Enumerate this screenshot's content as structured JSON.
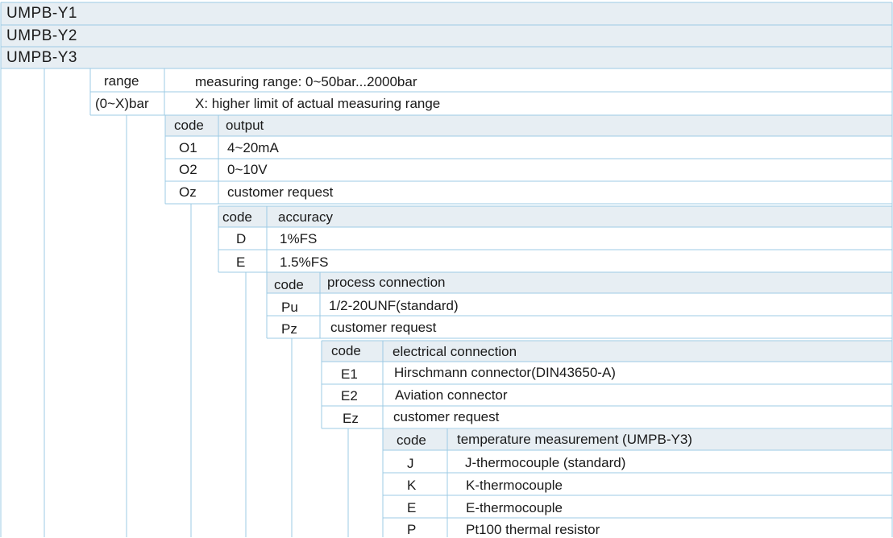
{
  "models": [
    "UMPB-Y1",
    "UMPB-Y2",
    "UMPB-Y3"
  ],
  "range": {
    "label": "range",
    "description": "measuring range: 0~50bar...2000bar",
    "code": "(0~X)bar",
    "code_description": "X: higher limit of actual measuring range"
  },
  "output": {
    "code_header": "code",
    "title": "output",
    "options": [
      {
        "code": "O1",
        "label": "4~20mA"
      },
      {
        "code": "O2",
        "label": "0~10V"
      },
      {
        "code": "Oz",
        "label": "customer request"
      }
    ]
  },
  "accuracy": {
    "code_header": "code",
    "title": "accuracy",
    "options": [
      {
        "code": "D",
        "label": "1%FS"
      },
      {
        "code": "E",
        "label": "1.5%FS"
      }
    ]
  },
  "process_connection": {
    "code_header": "code",
    "title": "process connection",
    "options": [
      {
        "code": "Pu",
        "label": "1/2-20UNF(standard)"
      },
      {
        "code": "Pz",
        "label": "customer request"
      }
    ]
  },
  "electrical_connection": {
    "code_header": "code",
    "title": "electrical connection",
    "options": [
      {
        "code": "E1",
        "label": "Hirschmann connector(DIN43650-A)"
      },
      {
        "code": "E2",
        "label": "Aviation connector"
      },
      {
        "code": "Ez",
        "label": "customer request"
      }
    ]
  },
  "temperature_measurement": {
    "code_header": "code",
    "title": "temperature measurement (UMPB-Y3)",
    "options": [
      {
        "code": "J",
        "label": "J-thermocouple (standard)"
      },
      {
        "code": "K",
        "label": "K-thermocouple"
      },
      {
        "code": "E",
        "label": "E-thermocouple"
      },
      {
        "code": "P",
        "label": "Pt100 thermal resistor"
      }
    ]
  }
}
